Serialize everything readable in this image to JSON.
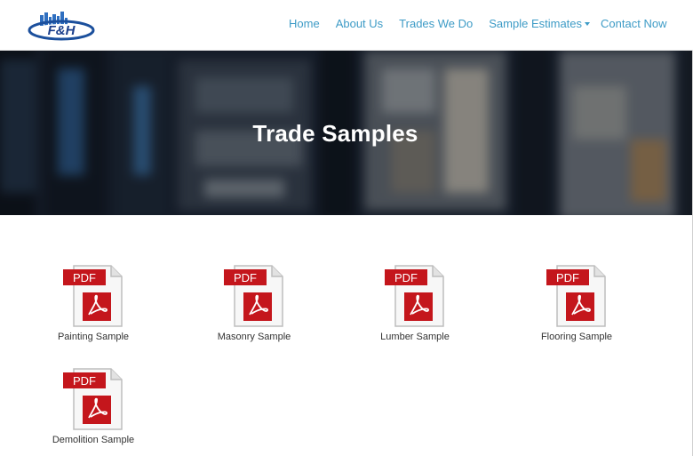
{
  "logo": {
    "text": "F&H"
  },
  "nav": {
    "items": [
      {
        "label": "Home"
      },
      {
        "label": "About Us"
      },
      {
        "label": "Trades We Do"
      },
      {
        "label": "Sample Estimates"
      },
      {
        "label": "Contact Now"
      }
    ]
  },
  "hero": {
    "title": "Trade Samples"
  },
  "samples": [
    {
      "label": "Painting Sample",
      "badge": "PDF",
      "icon": "pdf-file-icon"
    },
    {
      "label": "Masonry Sample",
      "badge": "PDF",
      "icon": "pdf-file-icon"
    },
    {
      "label": "Lumber Sample",
      "badge": "PDF",
      "icon": "pdf-file-icon"
    },
    {
      "label": "Flooring Sample",
      "badge": "PDF",
      "icon": "pdf-file-icon"
    },
    {
      "label": "Demolition Sample",
      "badge": "PDF",
      "icon": "pdf-file-icon"
    }
  ],
  "colors": {
    "nav_link": "#3d9bc6",
    "pdf_red": "#c4161c",
    "logo_blue": "#1b4f9c"
  }
}
